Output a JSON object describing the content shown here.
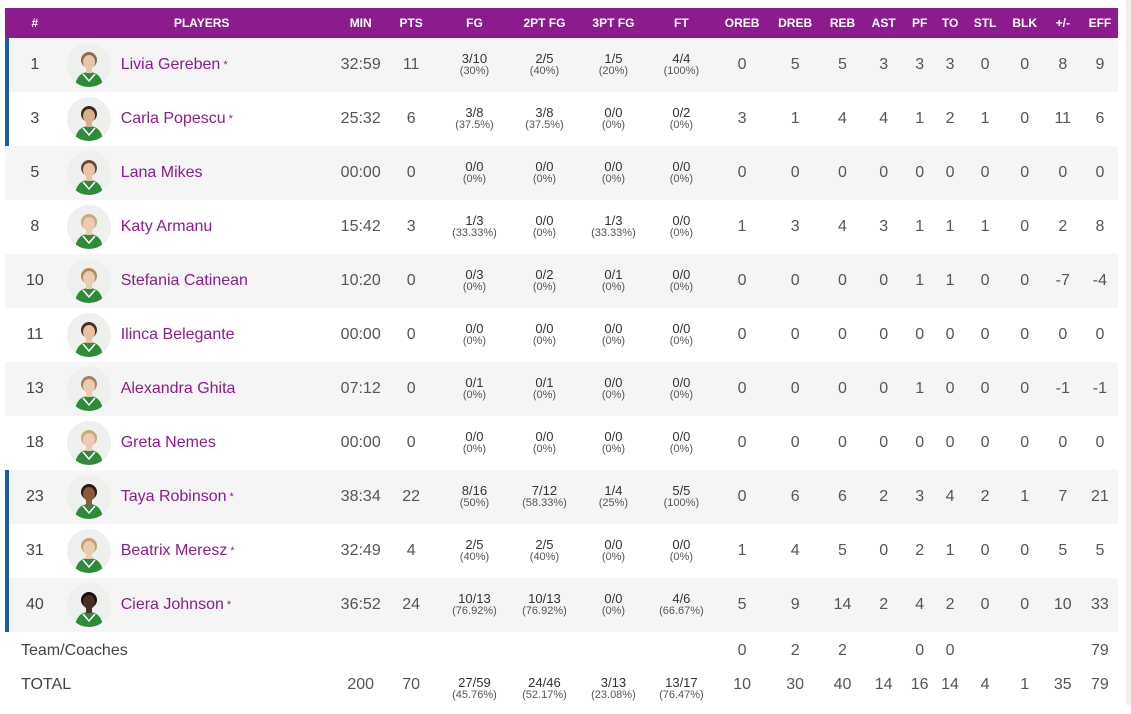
{
  "headers": [
    "#",
    "PLAYERS",
    "MIN",
    "PTS",
    "FG",
    "2PT FG",
    "3PT FG",
    "FT",
    "OREB",
    "DREB",
    "REB",
    "AST",
    "PF",
    "TO",
    "STL",
    "BLK",
    "+/-",
    "EFF"
  ],
  "players": [
    {
      "num": "1",
      "name": "Livia Gereben",
      "starter": true,
      "min": "32:59",
      "pts": "11",
      "fg": {
        "m": "3/10",
        "p": "(30%)"
      },
      "fg2": {
        "m": "2/5",
        "p": "(40%)"
      },
      "fg3": {
        "m": "1/5",
        "p": "(20%)"
      },
      "ft": {
        "m": "4/4",
        "p": "(100%)"
      },
      "oreb": "0",
      "dreb": "5",
      "reb": "5",
      "ast": "3",
      "pf": "3",
      "to": "3",
      "stl": "0",
      "blk": "0",
      "pm": "8",
      "eff": "9",
      "skin": "#e7c7a8",
      "hair": "#8a6a4a"
    },
    {
      "num": "3",
      "name": "Carla Popescu",
      "starter": true,
      "min": "25:32",
      "pts": "6",
      "fg": {
        "m": "3/8",
        "p": "(37.5%)"
      },
      "fg2": {
        "m": "3/8",
        "p": "(37.5%)"
      },
      "fg3": {
        "m": "0/0",
        "p": "(0%)"
      },
      "ft": {
        "m": "0/2",
        "p": "(0%)"
      },
      "oreb": "3",
      "dreb": "1",
      "reb": "4",
      "ast": "4",
      "pf": "1",
      "to": "2",
      "stl": "1",
      "blk": "0",
      "pm": "11",
      "eff": "6",
      "skin": "#d9b08c",
      "hair": "#3a2a1e"
    },
    {
      "num": "5",
      "name": "Lana Mikes",
      "starter": false,
      "min": "00:00",
      "pts": "0",
      "fg": {
        "m": "0/0",
        "p": "(0%)"
      },
      "fg2": {
        "m": "0/0",
        "p": "(0%)"
      },
      "fg3": {
        "m": "0/0",
        "p": "(0%)"
      },
      "ft": {
        "m": "0/0",
        "p": "(0%)"
      },
      "oreb": "0",
      "dreb": "0",
      "reb": "0",
      "ast": "0",
      "pf": "0",
      "to": "0",
      "stl": "0",
      "blk": "0",
      "pm": "0",
      "eff": "0",
      "skin": "#e8c4a4",
      "hair": "#6b4a30"
    },
    {
      "num": "8",
      "name": "Katy Armanu",
      "starter": false,
      "min": "15:42",
      "pts": "3",
      "fg": {
        "m": "1/3",
        "p": "(33.33%)"
      },
      "fg2": {
        "m": "0/0",
        "p": "(0%)"
      },
      "fg3": {
        "m": "1/3",
        "p": "(33.33%)"
      },
      "ft": {
        "m": "0/0",
        "p": "(0%)"
      },
      "oreb": "1",
      "dreb": "3",
      "reb": "4",
      "ast": "3",
      "pf": "1",
      "to": "1",
      "stl": "1",
      "blk": "0",
      "pm": "2",
      "eff": "8",
      "skin": "#ecccb0",
      "hair": "#c9a97a"
    },
    {
      "num": "10",
      "name": "Stefania Catinean",
      "starter": false,
      "min": "10:20",
      "pts": "0",
      "fg": {
        "m": "0/3",
        "p": "(0%)"
      },
      "fg2": {
        "m": "0/2",
        "p": "(0%)"
      },
      "fg3": {
        "m": "0/1",
        "p": "(0%)"
      },
      "ft": {
        "m": "0/0",
        "p": "(0%)"
      },
      "oreb": "0",
      "dreb": "0",
      "reb": "0",
      "ast": "0",
      "pf": "1",
      "to": "1",
      "stl": "0",
      "blk": "0",
      "pm": "-7",
      "eff": "-4",
      "skin": "#ecccb0",
      "hair": "#b08a5a"
    },
    {
      "num": "11",
      "name": "Ilinca Belegante",
      "starter": false,
      "min": "00:00",
      "pts": "0",
      "fg": {
        "m": "0/0",
        "p": "(0%)"
      },
      "fg2": {
        "m": "0/0",
        "p": "(0%)"
      },
      "fg3": {
        "m": "0/0",
        "p": "(0%)"
      },
      "ft": {
        "m": "0/0",
        "p": "(0%)"
      },
      "oreb": "0",
      "dreb": "0",
      "reb": "0",
      "ast": "0",
      "pf": "0",
      "to": "0",
      "stl": "0",
      "blk": "0",
      "pm": "0",
      "eff": "0",
      "skin": "#e6c2a0",
      "hair": "#4a3020"
    },
    {
      "num": "13",
      "name": "Alexandra Ghita",
      "starter": false,
      "min": "07:12",
      "pts": "0",
      "fg": {
        "m": "0/1",
        "p": "(0%)"
      },
      "fg2": {
        "m": "0/1",
        "p": "(0%)"
      },
      "fg3": {
        "m": "0/0",
        "p": "(0%)"
      },
      "ft": {
        "m": "0/0",
        "p": "(0%)"
      },
      "oreb": "0",
      "dreb": "0",
      "reb": "0",
      "ast": "0",
      "pf": "1",
      "to": "0",
      "stl": "0",
      "blk": "0",
      "pm": "-1",
      "eff": "-1",
      "skin": "#ecccb0",
      "hair": "#a08060"
    },
    {
      "num": "18",
      "name": "Greta Nemes",
      "starter": false,
      "min": "00:00",
      "pts": "0",
      "fg": {
        "m": "0/0",
        "p": "(0%)"
      },
      "fg2": {
        "m": "0/0",
        "p": "(0%)"
      },
      "fg3": {
        "m": "0/0",
        "p": "(0%)"
      },
      "ft": {
        "m": "0/0",
        "p": "(0%)"
      },
      "oreb": "0",
      "dreb": "0",
      "reb": "0",
      "ast": "0",
      "pf": "0",
      "to": "0",
      "stl": "0",
      "blk": "0",
      "pm": "0",
      "eff": "0",
      "skin": "#ecccb0",
      "hair": "#c9a870"
    },
    {
      "num": "23",
      "name": "Taya Robinson",
      "starter": true,
      "min": "38:34",
      "pts": "22",
      "fg": {
        "m": "8/16",
        "p": "(50%)"
      },
      "fg2": {
        "m": "7/12",
        "p": "(58.33%)"
      },
      "fg3": {
        "m": "1/4",
        "p": "(25%)"
      },
      "ft": {
        "m": "5/5",
        "p": "(100%)"
      },
      "oreb": "0",
      "dreb": "6",
      "reb": "6",
      "ast": "2",
      "pf": "3",
      "to": "4",
      "stl": "2",
      "blk": "1",
      "pm": "7",
      "eff": "21",
      "skin": "#8a5a3a",
      "hair": "#2a1a10"
    },
    {
      "num": "31",
      "name": "Beatrix Meresz",
      "starter": true,
      "min": "32:49",
      "pts": "4",
      "fg": {
        "m": "2/5",
        "p": "(40%)"
      },
      "fg2": {
        "m": "2/5",
        "p": "(40%)"
      },
      "fg3": {
        "m": "0/0",
        "p": "(0%)"
      },
      "ft": {
        "m": "0/0",
        "p": "(0%)"
      },
      "oreb": "1",
      "dreb": "4",
      "reb": "5",
      "ast": "0",
      "pf": "2",
      "to": "1",
      "stl": "0",
      "blk": "0",
      "pm": "5",
      "eff": "5",
      "skin": "#ecccb0",
      "hair": "#c4a070"
    },
    {
      "num": "40",
      "name": "Ciera Johnson",
      "starter": true,
      "min": "36:52",
      "pts": "24",
      "fg": {
        "m": "10/13",
        "p": "(76.92%)"
      },
      "fg2": {
        "m": "10/13",
        "p": "(76.92%)"
      },
      "fg3": {
        "m": "0/0",
        "p": "(0%)"
      },
      "ft": {
        "m": "4/6",
        "p": "(66.67%)"
      },
      "oreb": "5",
      "dreb": "9",
      "reb": "14",
      "ast": "2",
      "pf": "4",
      "to": "2",
      "stl": "0",
      "blk": "0",
      "pm": "10",
      "eff": "33",
      "skin": "#4a2e20",
      "hair": "#1a0f08"
    }
  ],
  "team": {
    "label": "Team/Coaches",
    "oreb": "0",
    "dreb": "2",
    "reb": "2",
    "ast": "",
    "pf": "0",
    "to": "0",
    "stl": "",
    "blk": "",
    "pm": "",
    "eff": "79"
  },
  "total": {
    "label": "TOTAL",
    "min": "200",
    "pts": "70",
    "fg": {
      "m": "27/59",
      "p": "(45.76%)"
    },
    "fg2": {
      "m": "24/46",
      "p": "(52.17%)"
    },
    "fg3": {
      "m": "3/13",
      "p": "(23.08%)"
    },
    "ft": {
      "m": "13/17",
      "p": "(76.47%)"
    },
    "oreb": "10",
    "dreb": "30",
    "reb": "40",
    "ast": "14",
    "pf": "16",
    "to": "14",
    "stl": "4",
    "blk": "1",
    "pm": "35",
    "eff": "79"
  },
  "colors": {
    "header_bg": "#8c1c8e",
    "name": "#8c1c8e",
    "starter_bar": "#1a5ea0",
    "jersey": "#2f8a3a"
  }
}
